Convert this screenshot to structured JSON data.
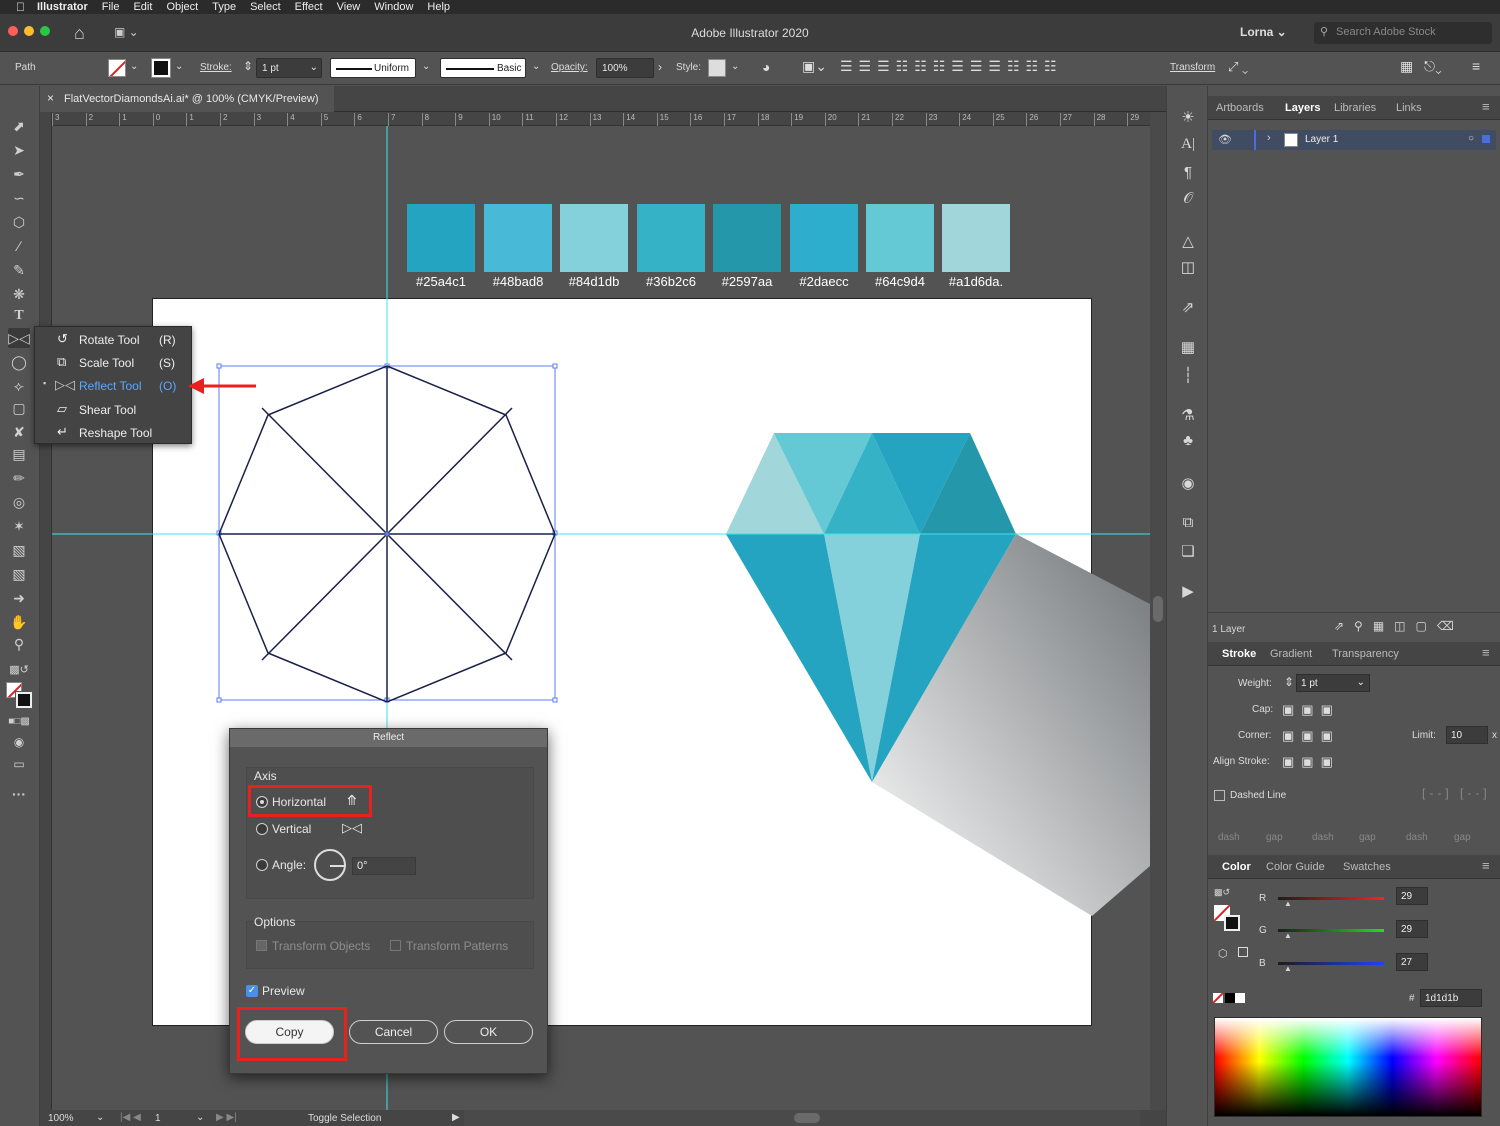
{
  "menubar": {
    "app": "Illustrator",
    "items": [
      "File",
      "Edit",
      "Object",
      "Type",
      "Select",
      "Effect",
      "View",
      "Window",
      "Help"
    ]
  },
  "window": {
    "title": "Adobe Illustrator 2020",
    "user": "Lorna",
    "stock_placeholder": "Search Adobe Stock"
  },
  "control_bar": {
    "selection": "Path",
    "stroke_label": "Stroke:",
    "stroke_weight": "1 pt",
    "profile": "Uniform",
    "brush": "Basic",
    "opacity_label": "Opacity:",
    "opacity": "100%",
    "style_label": "Style:",
    "transform_label": "Transform"
  },
  "document": {
    "tab": "FlatVectorDiamondsAi.ai* @ 100% (CMYK/Preview)"
  },
  "ruler_labels": [
    "3",
    "2",
    "1",
    "0",
    "1",
    "2",
    "3",
    "4",
    "5",
    "6",
    "7",
    "8",
    "9",
    "10",
    "11",
    "12",
    "13",
    "14",
    "15",
    "16",
    "17",
    "18",
    "19",
    "20",
    "21",
    "22",
    "23",
    "24",
    "25",
    "26",
    "27",
    "28",
    "29"
  ],
  "swatches": [
    {
      "hex": "#25a4c1",
      "label": "#25a4c1"
    },
    {
      "hex": "#48bad8",
      "label": "#48bad8"
    },
    {
      "hex": "#84d1db",
      "label": "#84d1db"
    },
    {
      "hex": "#36b2c6",
      "label": "#36b2c6"
    },
    {
      "hex": "#2597aa",
      "label": "#2597aa"
    },
    {
      "hex": "#2daecc",
      "label": "#2daecc"
    },
    {
      "hex": "#64c9d4",
      "label": "#64c9d4"
    },
    {
      "hex": "#a1d6da",
      "label": "#a1d6da."
    }
  ],
  "flyout": {
    "items": [
      {
        "label": "Rotate Tool",
        "key": "(R)"
      },
      {
        "label": "Scale Tool",
        "key": "(S)"
      },
      {
        "label": "Reflect Tool",
        "key": "(O)"
      },
      {
        "label": "Shear Tool",
        "key": ""
      },
      {
        "label": "Reshape Tool",
        "key": ""
      }
    ]
  },
  "dialog": {
    "title": "Reflect",
    "axis_label": "Axis",
    "horizontal": "Horizontal",
    "vertical": "Vertical",
    "angle_label": "Angle:",
    "angle_value": "0°",
    "options_label": "Options",
    "transform_objects": "Transform Objects",
    "transform_patterns": "Transform Patterns",
    "preview": "Preview",
    "copy": "Copy",
    "cancel": "Cancel",
    "ok": "OK"
  },
  "layers_panel": {
    "tabs": [
      "Artboards",
      "Layers",
      "Libraries",
      "Links"
    ],
    "active_tab": "Layers",
    "layer_name": "Layer 1",
    "count": "1 Layer"
  },
  "stroke_panel": {
    "tabs": [
      "Stroke",
      "Gradient",
      "Transparency"
    ],
    "weight_label": "Weight:",
    "weight": "1 pt",
    "cap_label": "Cap:",
    "corner_label": "Corner:",
    "limit_label": "Limit:",
    "limit": "10",
    "align_label": "Align Stroke:",
    "dashed_label": "Dashed Line",
    "dash_labels": [
      "dash",
      "gap",
      "dash",
      "gap",
      "dash",
      "gap"
    ]
  },
  "color_panel": {
    "tabs": [
      "Color",
      "Color Guide",
      "Swatches"
    ],
    "r_label": "R",
    "g_label": "G",
    "b_label": "B",
    "r": "29",
    "g": "29",
    "b": "27",
    "hex_label": "#",
    "hex": "1d1d1b"
  },
  "status_bar": {
    "zoom": "100%",
    "artboard": "1",
    "mode": "Toggle Selection"
  }
}
